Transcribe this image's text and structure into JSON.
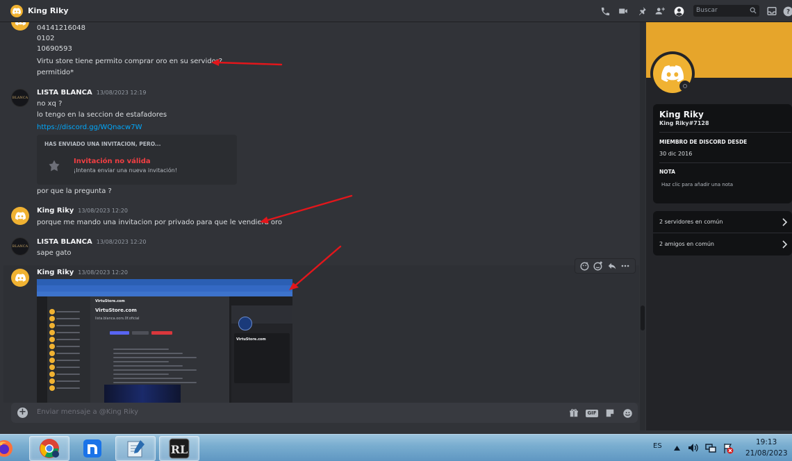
{
  "topbar": {
    "title": "King Riky",
    "search_placeholder": "Buscar",
    "icons": [
      "thread-icon",
      "video-icon",
      "pin-icon",
      "add-member-icon",
      "profile-toggle-icon",
      "inbox-icon",
      "help-icon"
    ]
  },
  "messages": {
    "m0": {
      "lines": [
        "04141216048",
        "0102",
        "10690593",
        "Virtu store tiene permito comprar oro en su servidor?",
        "permitido*"
      ]
    },
    "m1": {
      "author": "LISTA BLANCA",
      "timestamp": "13/08/2023 12:19",
      "avatar_text": "BLANCA",
      "lines": [
        "no xq ?",
        "lo tengo en la seccion de estafadores"
      ],
      "link": "https://discord.gg/WQnacw7W",
      "invite": {
        "heading": "HAS ENVIADO UNA INVITACION, PERO...",
        "title": "Invitación no válida",
        "subtitle": "¡Intenta enviar una nueva invitación!"
      },
      "after": "por que la pregunta ?"
    },
    "m2": {
      "author": "King Riky",
      "timestamp": "13/08/2023 12:20",
      "text": "porque me mando una invitacion por privado para que le vendiera oro"
    },
    "m3": {
      "author": "LISTA BLANCA",
      "timestamp": "13/08/2023 12:20",
      "avatar_text": "BLANCA",
      "text": "sape gato"
    },
    "m4": {
      "author": "King Riky",
      "timestamp": "13/08/2023 12:20",
      "attachment": "screenshot-image"
    }
  },
  "embedded_screenshot": {
    "server_name": "VirtuStore.com",
    "channel": "lista.blanca.oors.0f.oficial",
    "profile_name": "VirtuStore.com"
  },
  "input": {
    "placeholder": "Enviar mensaje a @King Riky",
    "gif_label": "GIF"
  },
  "profile": {
    "name": "King Riky",
    "tag": "King Riky#7128",
    "member_since_label": "MIEMBRO DE DISCORD DESDE",
    "member_since": "30 dic 2016",
    "note_label": "NOTA",
    "note_placeholder": "Haz clic para añadir una nota",
    "mutual_servers": "2 servidores en común",
    "mutual_friends": "2 amigos en común"
  },
  "taskbar": {
    "language": "ES",
    "time": "19:13",
    "date": "21/08/2023",
    "apps": [
      "firefox",
      "chrome",
      "nextcloud-n",
      "notepad",
      "rl-game"
    ]
  },
  "colors": {
    "accent_yellow": "#f0b232",
    "banner": "#e6a52b",
    "link": "#00a8fc",
    "error_red": "#f23f43",
    "arrow_red": "#e3161b"
  }
}
